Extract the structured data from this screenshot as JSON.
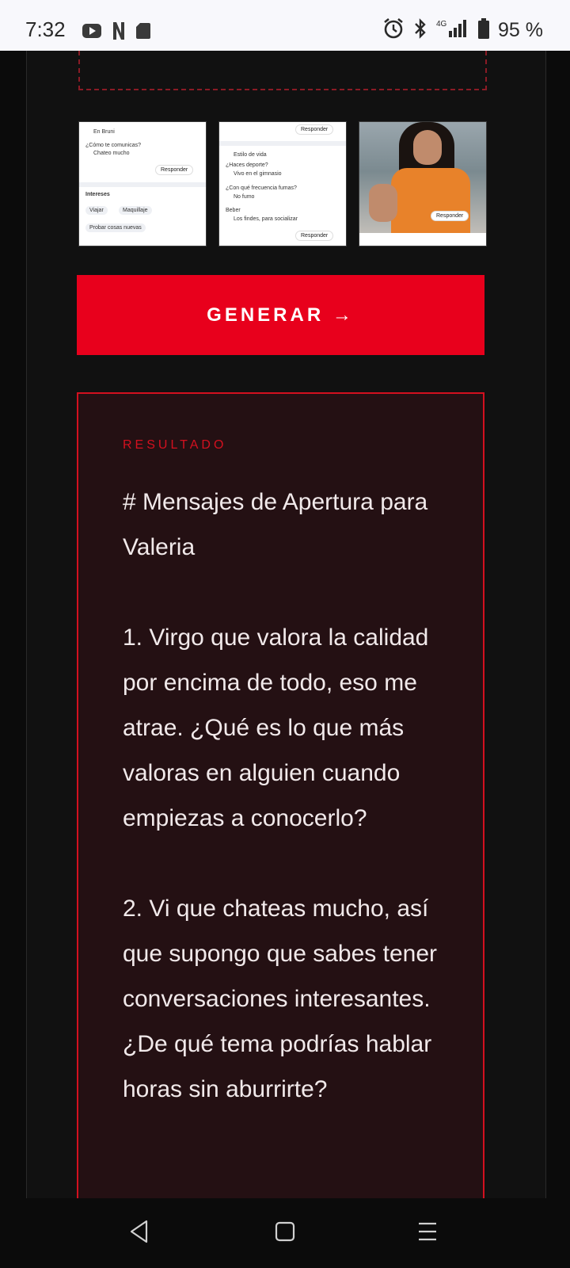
{
  "status_bar": {
    "time": "7:32",
    "left_icons": [
      "youtube-icon",
      "netflix-icon",
      "sd-card-icon"
    ],
    "right_icons": [
      "alarm-icon",
      "bluetooth-icon",
      "signal-4g-icon",
      "battery-icon"
    ],
    "network": "4G",
    "battery": "95 %"
  },
  "thumbnails": [
    {
      "lines": [
        "En Bruni",
        "¿Cómo te comunicas?",
        "Chateo mucho",
        "Intereses"
      ],
      "respond": "Responder",
      "chips": [
        "Viajar",
        "Maquillaje",
        "Probar cosas nuevas"
      ]
    },
    {
      "lines": [
        "Estilo de vida",
        "¿Haces deporte?",
        "Vivo en el gimnasio",
        "¿Con qué frecuencia fumas?",
        "No fumo",
        "Beber",
        "Los findes, para socializar"
      ],
      "respond": "Responder"
    },
    {
      "respond": "Responder"
    }
  ],
  "generate_button": "GENERAR →",
  "result": {
    "label": "RESULTADO",
    "heading": "# Mensajes de Apertura para Valeria",
    "message_1": "1. Virgo que valora la calidad por encima de todo, eso me atrae. ¿Qué es lo que más valoras en alguien cuando empiezas a conocerlo?",
    "message_2": "2. Vi que chateas mucho, así que supongo que sabes tener conversaciones interesantes. ¿De qué tema podrías hablar horas sin aburrirte?"
  },
  "nav_bar": {
    "icons": [
      "back-icon",
      "home-icon",
      "menu-icon"
    ]
  },
  "colors": {
    "accent": "#e8001c",
    "result_bg": "#241013",
    "page_bg": "#111111",
    "status_bar_bg": "#f8f8fc"
  }
}
